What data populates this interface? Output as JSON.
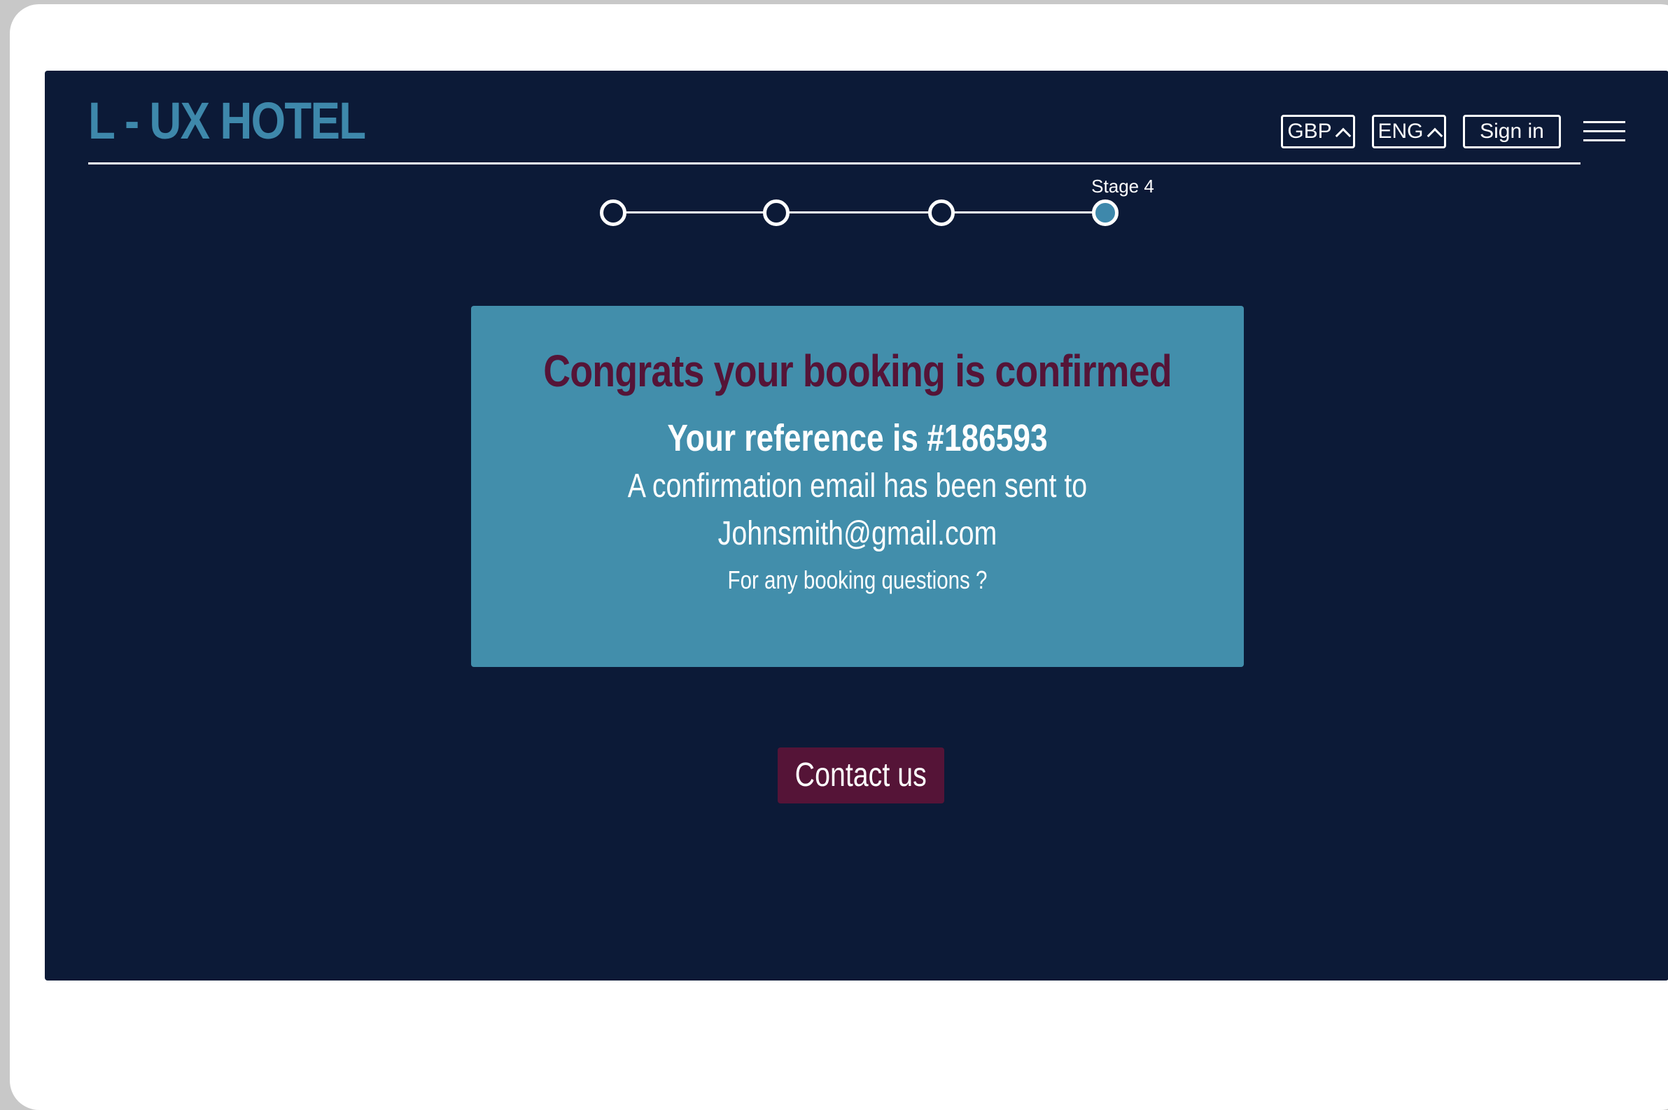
{
  "brand": {
    "logo_text": "L - UX HOTEL",
    "color": "#3e88ab"
  },
  "header": {
    "currency_label": "GBP",
    "language_label": "ENG",
    "signin_label": "Sign in",
    "menu_icon": "hamburger-menu-icon"
  },
  "stepper": {
    "total_steps": 4,
    "current_step": 4,
    "current_label": "Stage 4"
  },
  "confirmation": {
    "title": "Congrats your booking is confirmed",
    "reference_line": "Your reference is  #186593",
    "email_line_1": "A confirmation email has been sent to",
    "email_line_2": "Johnsmith@gmail.com",
    "questions_line": "For any booking questions ?"
  },
  "contact": {
    "button_label": "Contact us"
  },
  "colors": {
    "background": "#0c1a37",
    "card": "#428eab",
    "accent": "#551437",
    "text": "#ffffff"
  }
}
